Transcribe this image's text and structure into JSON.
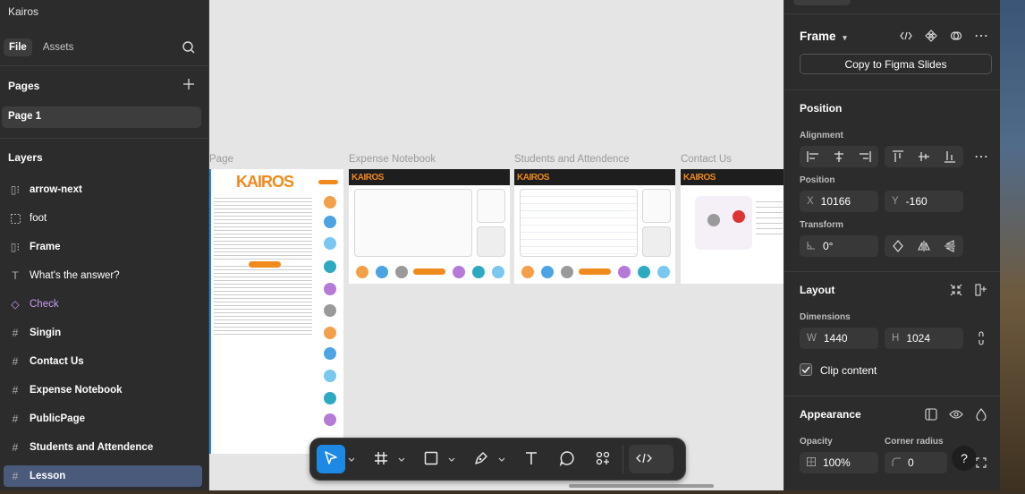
{
  "app": {
    "title": "Kairos"
  },
  "left_tabs": {
    "file": "File",
    "assets": "Assets"
  },
  "pages": {
    "heading": "Pages",
    "items": [
      "Page 1"
    ]
  },
  "layers": {
    "heading": "Layers",
    "items": [
      {
        "name": "arrow-next",
        "kind": "frame-auto"
      },
      {
        "name": "foot",
        "kind": "frame-dashed"
      },
      {
        "name": "Frame",
        "kind": "frame-auto"
      },
      {
        "name": "What's the answer?",
        "kind": "text"
      },
      {
        "name": "Check",
        "kind": "component"
      },
      {
        "name": "Singin",
        "kind": "frame"
      },
      {
        "name": "Contact Us",
        "kind": "frame"
      },
      {
        "name": "Expense Notebook",
        "kind": "frame"
      },
      {
        "name": "PublicPage",
        "kind": "frame"
      },
      {
        "name": "Students and Attendence",
        "kind": "frame"
      },
      {
        "name": "Lesson",
        "kind": "frame"
      }
    ]
  },
  "canvas": {
    "frames": [
      {
        "label": "Page"
      },
      {
        "label": "Expense Notebook"
      },
      {
        "label": "Students and Attendence"
      },
      {
        "label": "Contact Us"
      }
    ],
    "logo_text": "KAIROS"
  },
  "right_panel": {
    "frame_title": "Frame",
    "copy_button": "Copy to Figma Slides",
    "position_title": "Position",
    "alignment_label": "Alignment",
    "position_label": "Position",
    "x_prefix": "X",
    "x_value": "10166",
    "y_prefix": "Y",
    "y_value": "-160",
    "transform_label": "Transform",
    "rotation_value": "0°",
    "layout_title": "Layout",
    "dimensions_label": "Dimensions",
    "w_prefix": "W",
    "w_value": "1440",
    "h_prefix": "H",
    "h_value": "1024",
    "clip_content": "Clip content",
    "appearance_title": "Appearance",
    "opacity_label": "Opacity",
    "opacity_value": "100%",
    "corner_radius_label": "Corner radius",
    "corner_radius_value": "0",
    "help": "?"
  },
  "colors": {
    "accent": "#1e88e5",
    "panel_bg": "#2c2c2c",
    "canvas_bg": "#e5e5e5",
    "component": "#c89bf5",
    "selection": "#4a5a7a"
  }
}
